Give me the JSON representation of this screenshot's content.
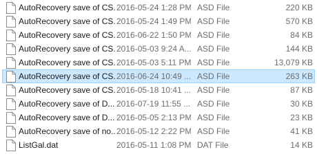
{
  "files": [
    {
      "icon": "document-icon",
      "name": "AutoRecovery save of CS...",
      "date": "2016-05-24 1:28 PM",
      "type": "ASD File",
      "size": "220 KB",
      "selected": false
    },
    {
      "icon": "document-icon",
      "name": "AutoRecovery save of CS...",
      "date": "2016-05-24 1:49 PM",
      "type": "ASD File",
      "size": "570 KB",
      "selected": false
    },
    {
      "icon": "document-icon",
      "name": "AutoRecovery save of CS...",
      "date": "2016-06-22 1:50 PM",
      "type": "ASD File",
      "size": "84 KB",
      "selected": false
    },
    {
      "icon": "document-icon",
      "name": "AutoRecovery save of CS...",
      "date": "2016-05-03 9:24 A...",
      "type": "ASD File",
      "size": "144 KB",
      "selected": false
    },
    {
      "icon": "document-icon",
      "name": "AutoRecovery save of CS...",
      "date": "2016-05-03 5:11 PM",
      "type": "ASD File",
      "size": "13,079 KB",
      "selected": false
    },
    {
      "icon": "document-icon",
      "name": "AutoRecovery save of CS...",
      "date": "2016-06-24 10:49 ...",
      "type": "ASD File",
      "size": "263 KB",
      "selected": true
    },
    {
      "icon": "document-icon",
      "name": "AutoRecovery save of CS...",
      "date": "2016-05-18 10:41 ...",
      "type": "ASD File",
      "size": "87 KB",
      "selected": false
    },
    {
      "icon": "document-icon",
      "name": "AutoRecovery save of D...",
      "date": "2016-07-19 11:55 ...",
      "type": "ASD File",
      "size": "30 KB",
      "selected": false
    },
    {
      "icon": "document-icon",
      "name": "AutoRecovery save of D...",
      "date": "2016-05-05 2:13 PM",
      "type": "ASD File",
      "size": "23 KB",
      "selected": false
    },
    {
      "icon": "document-icon",
      "name": "AutoRecovery save of no...",
      "date": "2016-05-12 2:22 PM",
      "type": "ASD File",
      "size": "41 KB",
      "selected": false
    },
    {
      "icon": "document-icon",
      "name": "ListGal.dat",
      "date": "2016-05-11 1:08 PM",
      "type": "DAT File",
      "size": "14 KB",
      "selected": false
    }
  ],
  "colors": {
    "selected_background": "#cce8ff",
    "selected_border": "#99d1ff",
    "secondary_text": "#6d6d6d",
    "primary_text": "#1a1a1a"
  }
}
